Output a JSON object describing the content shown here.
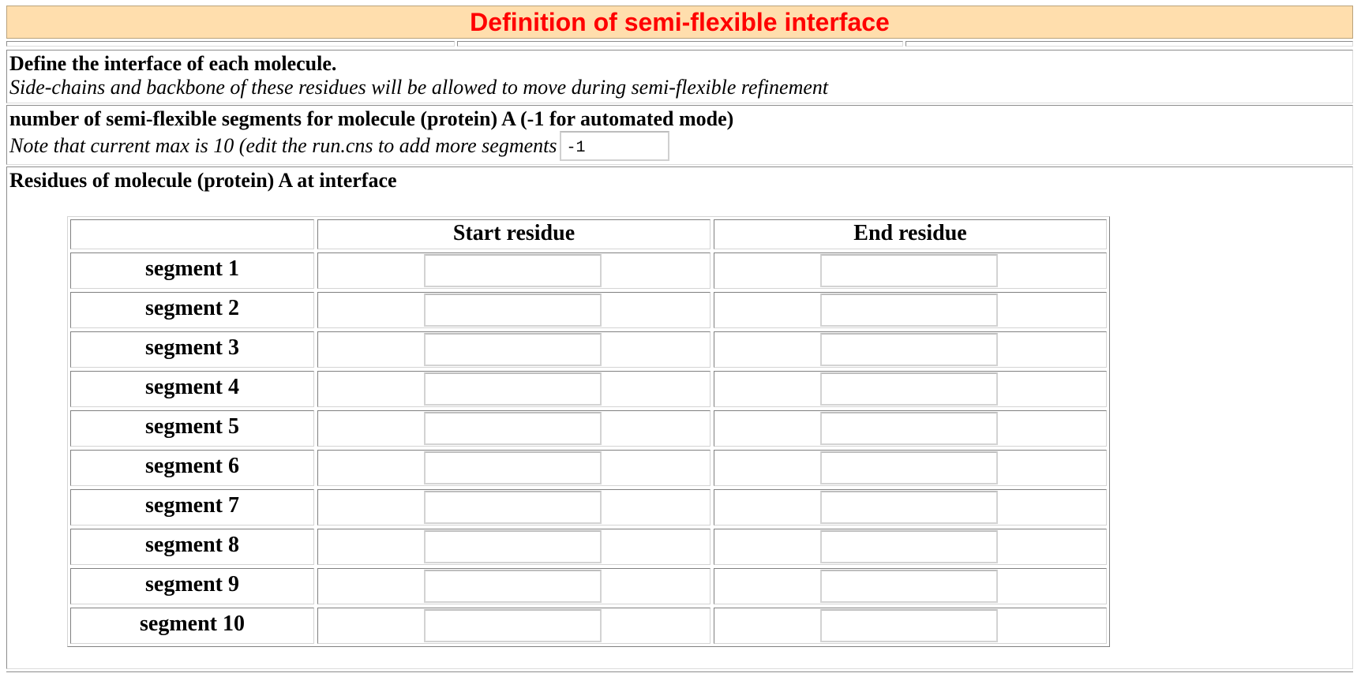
{
  "title": "Definition of semi-flexible interface",
  "colors": {
    "title_bg": "#ffdead",
    "title_text": "#ff0000"
  },
  "intro": {
    "heading": "Define the interface of each molecule.",
    "note": "Side-chains and backbone of these residues will be allowed to move during semi-flexible refinement"
  },
  "segments_count": {
    "label": "number of semi-flexible segments for molecule (protein) A (-1 for automated mode)",
    "note": "Note that current max is 10 (edit the run.cns to add more segments",
    "value": "-1"
  },
  "residues": {
    "heading": "Residues of molecule (protein) A at interface",
    "columns": [
      "",
      "Start residue",
      "End residue"
    ],
    "rows": [
      {
        "label": "segment 1",
        "start": "",
        "end": ""
      },
      {
        "label": "segment 2",
        "start": "",
        "end": ""
      },
      {
        "label": "segment 3",
        "start": "",
        "end": ""
      },
      {
        "label": "segment 4",
        "start": "",
        "end": ""
      },
      {
        "label": "segment 5",
        "start": "",
        "end": ""
      },
      {
        "label": "segment 6",
        "start": "",
        "end": ""
      },
      {
        "label": "segment 7",
        "start": "",
        "end": ""
      },
      {
        "label": "segment 8",
        "start": "",
        "end": ""
      },
      {
        "label": "segment 9",
        "start": "",
        "end": ""
      },
      {
        "label": "segment 10",
        "start": "",
        "end": ""
      }
    ]
  }
}
